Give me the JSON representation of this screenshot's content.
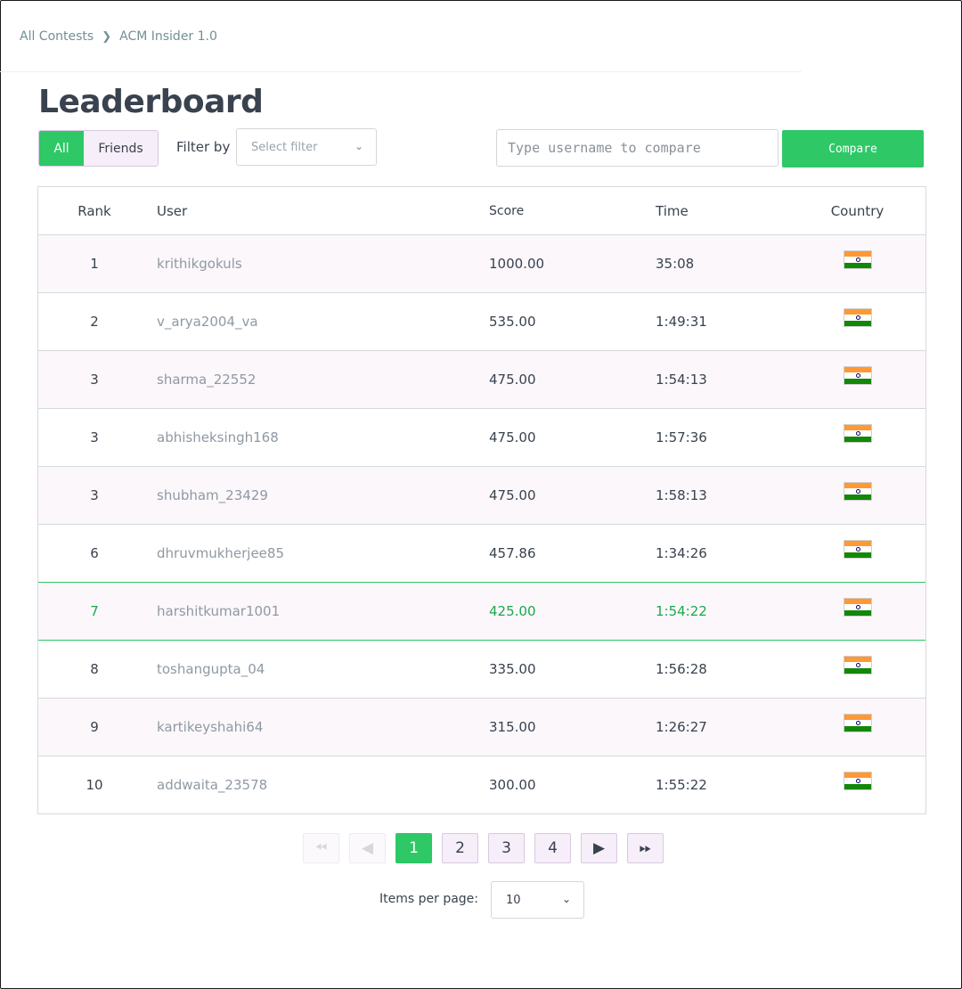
{
  "breadcrumb": {
    "root": "All Contests",
    "separator": ">",
    "current": "ACM Insider 1.0"
  },
  "page": {
    "title": "Leaderboard"
  },
  "toggle": {
    "all": "All",
    "friends": "Friends",
    "active": "All"
  },
  "filter": {
    "label": "Filter by",
    "placeholder": "Select filter"
  },
  "compare": {
    "placeholder": "Type username to compare",
    "button": "Compare"
  },
  "table": {
    "headers": {
      "rank": "Rank",
      "user": "User",
      "score": "Score",
      "time": "Time",
      "country": "Country"
    },
    "rows": [
      {
        "rank": "1",
        "user": "krithikgokuls",
        "score": "1000.00",
        "time": "35:08",
        "country": "India"
      },
      {
        "rank": "2",
        "user": "v_arya2004_va",
        "score": "535.00",
        "time": "1:49:31",
        "country": "India"
      },
      {
        "rank": "3",
        "user": "sharma_22552",
        "score": "475.00",
        "time": "1:54:13",
        "country": "India"
      },
      {
        "rank": "3",
        "user": "abhisheksingh168",
        "score": "475.00",
        "time": "1:57:36",
        "country": "India"
      },
      {
        "rank": "3",
        "user": "shubham_23429",
        "score": "475.00",
        "time": "1:58:13",
        "country": "India"
      },
      {
        "rank": "6",
        "user": "dhruvmukherjee85",
        "score": "457.86",
        "time": "1:34:26",
        "country": "India"
      },
      {
        "rank": "7",
        "user": "harshitkumar1001",
        "score": "425.00",
        "time": "1:54:22",
        "country": "India"
      },
      {
        "rank": "8",
        "user": "toshangupta_04",
        "score": "335.00",
        "time": "1:56:28",
        "country": "India"
      },
      {
        "rank": "9",
        "user": "kartikeyshahi64",
        "score": "315.00",
        "time": "1:26:27",
        "country": "India"
      },
      {
        "rank": "10",
        "user": "addwaita_23578",
        "score": "300.00",
        "time": "1:55:22",
        "country": "India"
      }
    ],
    "highlight_user": "harshitkumar1001"
  },
  "pagination": {
    "pages": [
      "1",
      "2",
      "3",
      "4"
    ],
    "current": "1",
    "first_icon": "double-chevron-left-icon",
    "prev_icon": "chevron-left-icon",
    "next_icon": "chevron-right-icon",
    "last_icon": "double-chevron-right-icon"
  },
  "items_per_page": {
    "label": "Items per page:",
    "value": "10"
  },
  "colors": {
    "accent": "#2ec866",
    "highlight_text": "#1ba94c",
    "row_tint": "#fbf7fb",
    "text": "#39424e"
  }
}
